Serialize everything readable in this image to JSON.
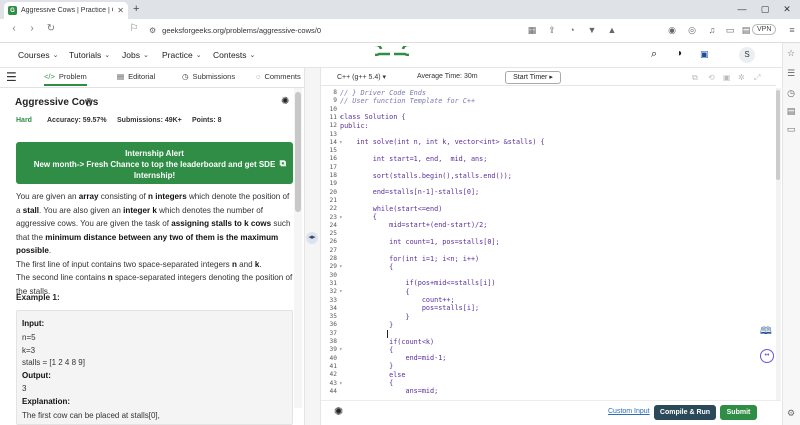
{
  "browser": {
    "tab_title": "Aggressive Cows | Practice | Gee",
    "favicon_text": "G",
    "url": "geeksforgeeks.org/problems/aggressive-cows/0",
    "vpn_label": "VPN"
  },
  "site_nav": {
    "logo_text": "GG",
    "items": [
      "Courses",
      "Tutorials",
      "Jobs",
      "Practice",
      "Contests"
    ],
    "user_initial": "S"
  },
  "left_tabs": {
    "problem": "Problem",
    "editorial": "Editorial",
    "submissions": "Submissions",
    "comments": "Comments"
  },
  "problem": {
    "title": "Aggressive Cows",
    "difficulty": "Hard",
    "accuracy": "Accuracy: 59.57%",
    "submissions": "Submissions: 49K+",
    "points": "Points: 8"
  },
  "alert": {
    "line1": "Internship Alert",
    "line2": "New month-> Fresh Chance to top the leaderboard and get SDE",
    "line3": "Internship!"
  },
  "description": {
    "p1a": "You are given an ",
    "p1b": "array",
    "p1c": " consisting of ",
    "p1d": "n integers",
    "p1e": " which denote the position of a ",
    "p1f": "stall",
    "p1g": ". You are also given an ",
    "p1h": "integer k",
    "p1i": " which denotes the number of aggressive cows. You are given the task of ",
    "p1j": "assigning stalls to k cows",
    "p1k": " such that the ",
    "p1l": "minimum distance between any two of them is the maximum possible",
    "p1m": ".",
    "p2a": "The first line of input contains two space-separated integers ",
    "p2b": "n",
    "p2c": " and ",
    "p2d": "k",
    "p2e": ".",
    "p3a": "The second line contains ",
    "p3b": "n",
    "p3c": " space-separated integers denoting the position of the stalls."
  },
  "example": {
    "title": "Example 1:",
    "input_label": "Input:",
    "n_line": "n=5",
    "k_line": "k=3",
    "stalls_line": "stalls = [1 2 4 8 9]",
    "output_label": "Output:",
    "output_value": "3",
    "explanation_label": "Explanation:",
    "explanation_text": "The first cow can be placed at stalls[0],"
  },
  "editor": {
    "language": "C++ (g++ 5.4)",
    "avg_time": "Average Time: 30m",
    "start_timer": "Start Timer",
    "lines": [
      {
        "n": "8",
        "fold": "",
        "text": "// } Driver Code Ends",
        "c": true
      },
      {
        "n": "9",
        "fold": "",
        "text": "// User function Template for C++",
        "c": true
      },
      {
        "n": "10",
        "fold": "",
        "text": ""
      },
      {
        "n": "11",
        "fold": "▾",
        "text": "class Solution {"
      },
      {
        "n": "12",
        "fold": "",
        "text": "public:"
      },
      {
        "n": "13",
        "fold": "",
        "text": ""
      },
      {
        "n": "14",
        "fold": "▾",
        "text": "    int solve(int n, int k, vector<int> &stalls) {"
      },
      {
        "n": "15",
        "fold": "",
        "text": ""
      },
      {
        "n": "16",
        "fold": "",
        "text": "        int start=1, end,  mid, ans;"
      },
      {
        "n": "17",
        "fold": "",
        "text": ""
      },
      {
        "n": "18",
        "fold": "",
        "text": "        sort(stalls.begin(),stalls.end());"
      },
      {
        "n": "19",
        "fold": "",
        "text": ""
      },
      {
        "n": "20",
        "fold": "",
        "text": "        end=stalls[n-1]-stalls[0];"
      },
      {
        "n": "21",
        "fold": "",
        "text": ""
      },
      {
        "n": "22",
        "fold": "",
        "text": "        while(start<=end)"
      },
      {
        "n": "23",
        "fold": "▾",
        "text": "        {"
      },
      {
        "n": "24",
        "fold": "",
        "text": "            mid=start+(end-start)/2;"
      },
      {
        "n": "25",
        "fold": "",
        "text": ""
      },
      {
        "n": "26",
        "fold": "",
        "text": "            int count=1, pos=stalls[0];"
      },
      {
        "n": "27",
        "fold": "",
        "text": ""
      },
      {
        "n": "28",
        "fold": "",
        "text": "            for(int i=1; i<n; i++)"
      },
      {
        "n": "29",
        "fold": "▾",
        "text": "            {"
      },
      {
        "n": "30",
        "fold": "",
        "text": ""
      },
      {
        "n": "31",
        "fold": "",
        "text": "                if(pos+mid<=stalls[i])"
      },
      {
        "n": "32",
        "fold": "▾",
        "text": "                {"
      },
      {
        "n": "33",
        "fold": "",
        "text": "                    count++;"
      },
      {
        "n": "34",
        "fold": "",
        "text": "                    pos=stalls[i];"
      },
      {
        "n": "35",
        "fold": "",
        "text": "                }"
      },
      {
        "n": "36",
        "fold": "",
        "text": "            }"
      },
      {
        "n": "37",
        "fold": "",
        "text": ""
      },
      {
        "n": "38",
        "fold": "",
        "text": "            if(count<k)"
      },
      {
        "n": "39",
        "fold": "▾",
        "text": "            {"
      },
      {
        "n": "40",
        "fold": "",
        "text": "                end=mid-1;"
      },
      {
        "n": "41",
        "fold": "",
        "text": "            }"
      },
      {
        "n": "42",
        "fold": "",
        "text": "            else"
      },
      {
        "n": "43",
        "fold": "▾",
        "text": "            {"
      },
      {
        "n": "44",
        "fold": "",
        "text": "                ans=mid;"
      }
    ],
    "custom_input": "Custom Input",
    "compile_run": "Compile & Run",
    "submit": "Submit"
  },
  "colors": {
    "brand_green": "#2f8d46",
    "run_button": "#2a4a59",
    "link_blue": "#2e6db3"
  },
  "icons": [
    "back-icon",
    "forward-icon",
    "reload-icon",
    "bookmark-icon",
    "search-icon",
    "theme-toggle-icon",
    "bug-report-icon",
    "lightbulb-icon",
    "book-icon",
    "chat-icon",
    "maximize-icon",
    "settings-icon"
  ]
}
